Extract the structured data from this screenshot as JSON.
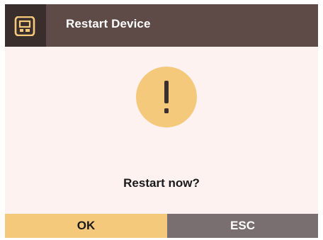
{
  "dialog": {
    "title": "Restart Device",
    "message": "Restart now?",
    "icon": "warning-exclamation-icon",
    "app_icon": "device-icon"
  },
  "buttons": {
    "ok_label": "OK",
    "esc_label": "ESC"
  },
  "colors": {
    "titlebar": "#5e4a47",
    "app_icon_bg": "#3a2e2c",
    "background": "#fdf2f0",
    "accent": "#f4c97c",
    "secondary_button": "#7a6f70"
  }
}
